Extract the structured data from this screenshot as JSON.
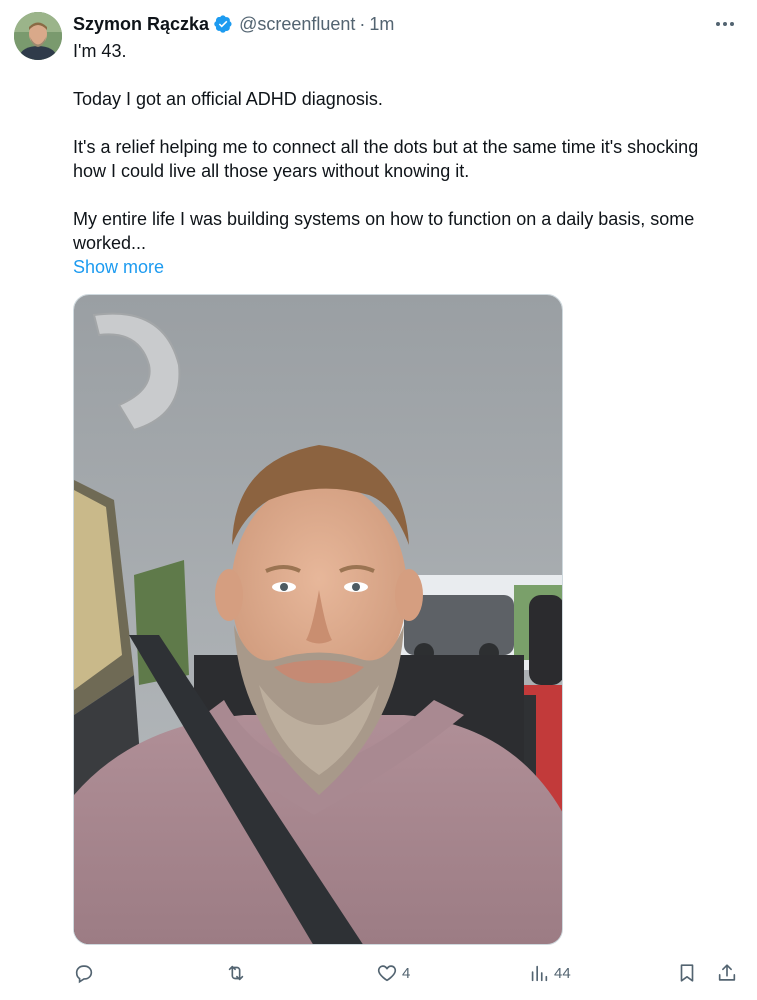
{
  "author": {
    "name": "Szymon Rączka",
    "handle": "@screenfluent",
    "separator": "·",
    "time": "1m",
    "verified_color": "#1d9bf0"
  },
  "tweet": {
    "paragraphs": [
      "I'm 43.",
      "Today I got an official ADHD diagnosis.",
      "It's a relief helping me to connect all the dots but at the same time it's shocking how I could live all those years without knowing it.",
      "My entire life I was building systems on how to function on a daily basis, some worked..."
    ],
    "show_more_label": "Show more"
  },
  "media": {
    "icon": "photo"
  },
  "actions": {
    "reply": {
      "icon": "reply-icon",
      "count": ""
    },
    "repost": {
      "icon": "repost-icon",
      "count": ""
    },
    "like": {
      "icon": "heart-icon",
      "count": "4"
    },
    "views": {
      "icon": "views-icon",
      "count": "44"
    },
    "bookmark": {
      "icon": "bookmark-icon"
    },
    "share": {
      "icon": "share-icon"
    }
  },
  "colors": {
    "text": "#0f1419",
    "secondary": "#536471",
    "link": "#1d9bf0"
  }
}
